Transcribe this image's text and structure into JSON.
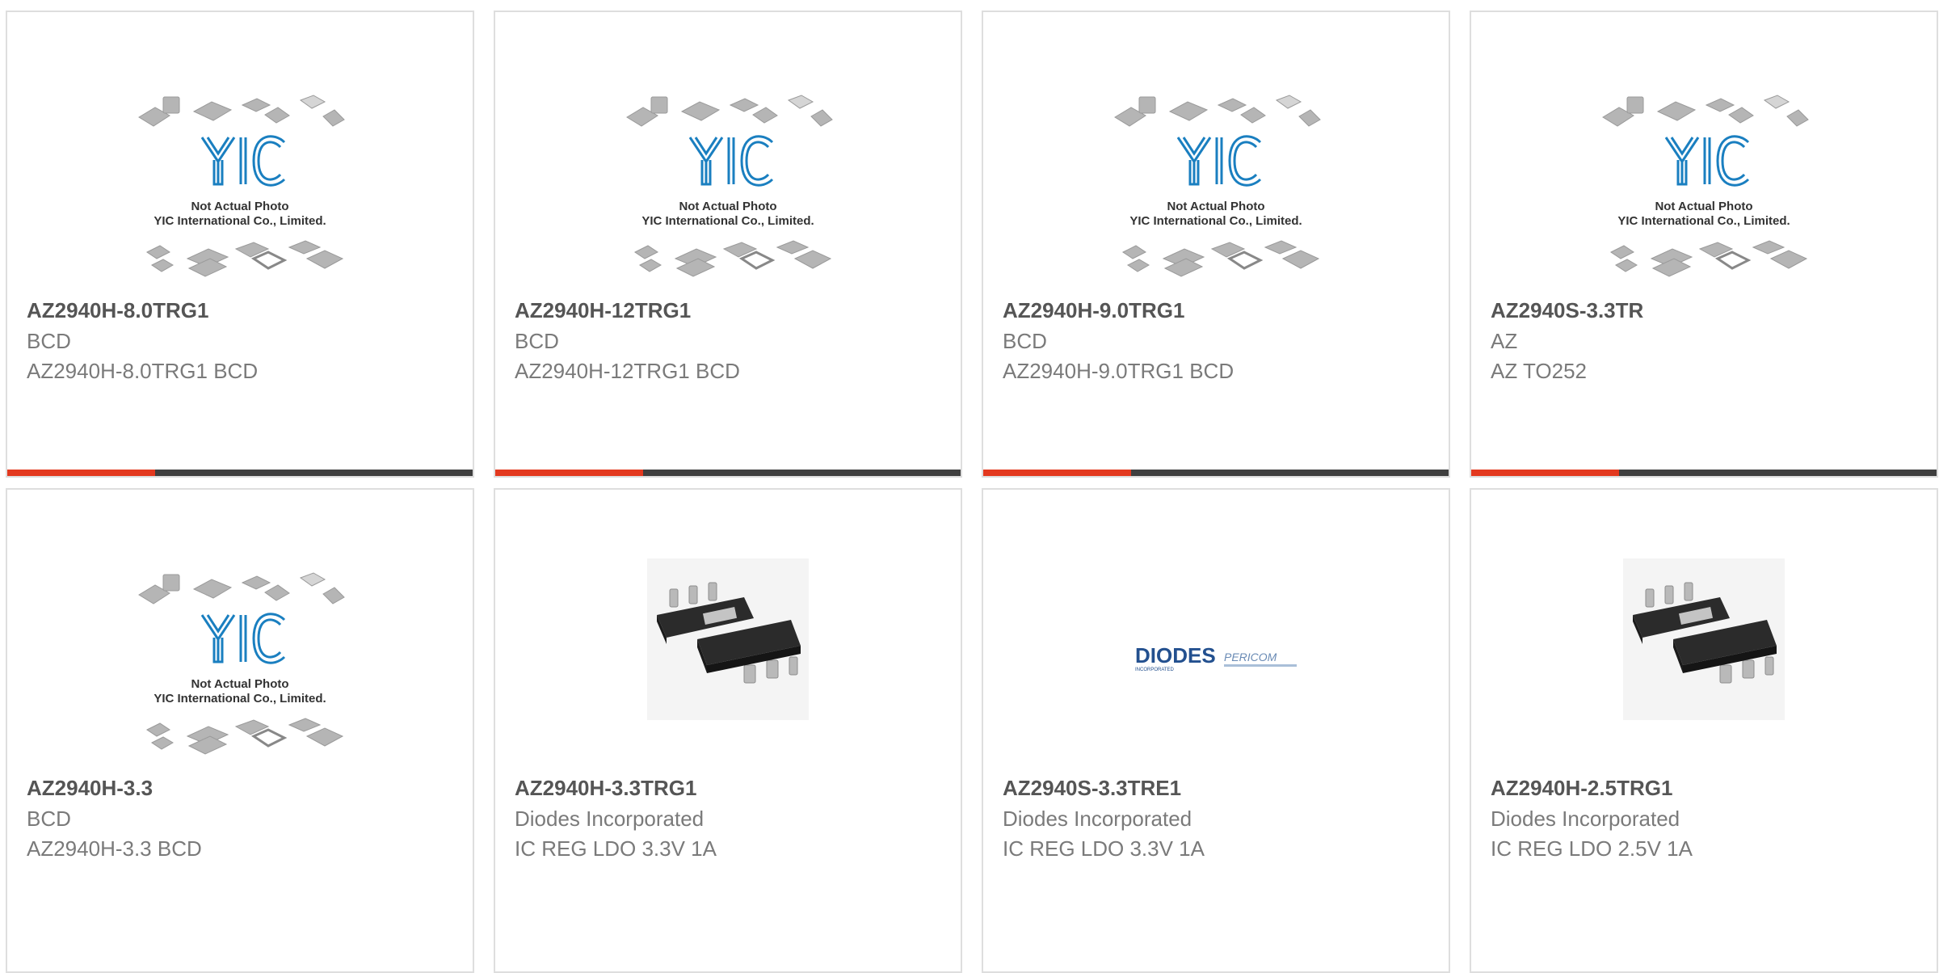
{
  "placeholder": {
    "line1": "Not Actual Photo",
    "line2": "YIC International Co., Limited.",
    "logo": "YIC"
  },
  "diodes_logo": {
    "brand": "DIODES",
    "brand_sub": "INCORPORATED",
    "partner": "PERICOM"
  },
  "colors": {
    "accent": "#e3391f",
    "bar_dark": "#3f3f3f",
    "border": "#dedede",
    "title": "#555555",
    "text": "#7a7a7a",
    "yic_blue": "#1a7fc0"
  },
  "products": [
    {
      "name": "AZ2940H-8.0TRG1",
      "manufacturer": "BCD",
      "description": "AZ2940H-8.0TRG1 BCD",
      "image": "yic-placeholder"
    },
    {
      "name": "AZ2940H-12TRG1",
      "manufacturer": "BCD",
      "description": "AZ2940H-12TRG1 BCD",
      "image": "yic-placeholder"
    },
    {
      "name": "AZ2940H-9.0TRG1",
      "manufacturer": "BCD",
      "description": "AZ2940H-9.0TRG1 BCD",
      "image": "yic-placeholder"
    },
    {
      "name": "AZ2940S-3.3TR",
      "manufacturer": "AZ",
      "description": "AZ TO252",
      "image": "yic-placeholder"
    },
    {
      "name": "AZ2940H-3.3",
      "manufacturer": "BCD",
      "description": "AZ2940H-3.3 BCD",
      "image": "yic-placeholder"
    },
    {
      "name": "AZ2940H-3.3TRG1",
      "manufacturer": "Diodes Incorporated",
      "description": "IC REG LDO 3.3V 1A",
      "image": "sot223-photo"
    },
    {
      "name": "AZ2940S-3.3TRE1",
      "manufacturer": "Diodes Incorporated",
      "description": "IC REG LDO 3.3V 1A",
      "image": "diodes-logo"
    },
    {
      "name": "AZ2940H-2.5TRG1",
      "manufacturer": "Diodes Incorporated",
      "description": "IC REG LDO 2.5V 1A",
      "image": "sot223-photo"
    }
  ]
}
